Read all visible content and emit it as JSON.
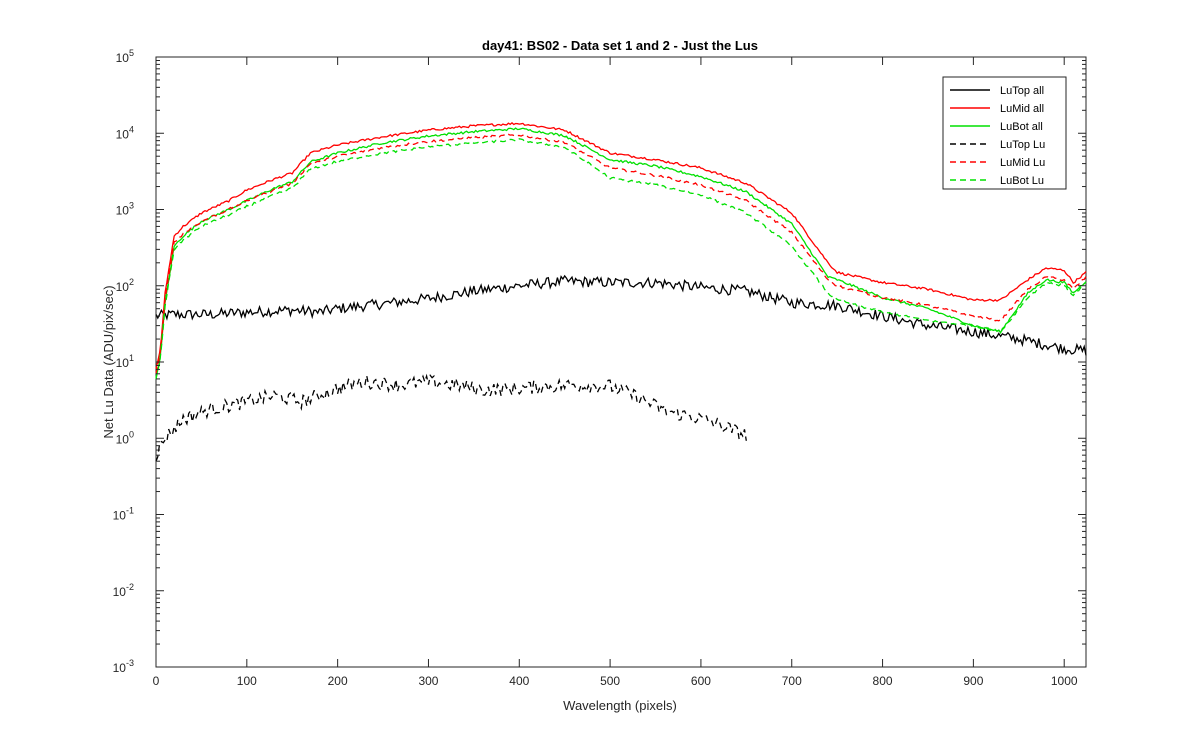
{
  "chart_data": {
    "type": "line",
    "title": "day41: BS02 - Data set 1 and 2 - Just the Lus",
    "xlabel": "Wavelength (pixels)",
    "ylabel": "Net Lu Data (ADU/pix/sec)",
    "xlim": [
      0,
      1024
    ],
    "ylim": [
      0.001,
      100000
    ],
    "yscale": "log",
    "grid": false,
    "legend_position": "top-right",
    "x_ticks": [
      "0",
      "100",
      "200",
      "300",
      "400",
      "500",
      "600",
      "700",
      "800",
      "900",
      "1000"
    ],
    "y_ticks": [
      {
        "base": "10",
        "exp": "-3"
      },
      {
        "base": "10",
        "exp": "-2"
      },
      {
        "base": "10",
        "exp": "-1"
      },
      {
        "base": "10",
        "exp": "0"
      },
      {
        "base": "10",
        "exp": "1"
      },
      {
        "base": "10",
        "exp": "2"
      },
      {
        "base": "10",
        "exp": "3"
      },
      {
        "base": "10",
        "exp": "4"
      },
      {
        "base": "10",
        "exp": "5"
      }
    ],
    "series": [
      {
        "name": "LuTop  all",
        "color": "#000000",
        "dash": "solid",
        "noise": 0.07,
        "x": [
          0,
          20,
          60,
          100,
          150,
          180,
          200,
          250,
          300,
          350,
          400,
          450,
          500,
          550,
          600,
          650,
          700,
          750,
          800,
          850,
          900,
          950,
          1000,
          1024
        ],
        "y": [
          40,
          42,
          42,
          45,
          48,
          45,
          50,
          58,
          68,
          85,
          100,
          115,
          110,
          110,
          95,
          85,
          60,
          55,
          40,
          30,
          25,
          20,
          15,
          14
        ]
      },
      {
        "name": "LuMid  all",
        "color": "#ff0000",
        "dash": "solid",
        "noise": 0.015,
        "x": [
          0,
          5,
          10,
          20,
          30,
          50,
          80,
          100,
          130,
          150,
          170,
          200,
          250,
          300,
          350,
          400,
          450,
          500,
          550,
          600,
          650,
          700,
          740,
          750,
          800,
          850,
          900,
          930,
          960,
          980,
          1000,
          1010,
          1024
        ],
        "y": [
          8,
          15,
          80,
          450,
          600,
          900,
          1300,
          1800,
          2500,
          3000,
          5500,
          7000,
          9000,
          11000,
          12500,
          13500,
          11000,
          5500,
          4500,
          3500,
          2200,
          900,
          200,
          150,
          110,
          90,
          65,
          65,
          120,
          170,
          160,
          110,
          150
        ]
      },
      {
        "name": "LuBot  all",
        "color": "#00e000",
        "dash": "solid",
        "noise": 0.015,
        "x": [
          0,
          5,
          10,
          20,
          30,
          50,
          80,
          100,
          130,
          150,
          170,
          200,
          250,
          300,
          350,
          400,
          450,
          500,
          550,
          600,
          650,
          700,
          740,
          750,
          800,
          850,
          900,
          930,
          960,
          980,
          1000,
          1010,
          1024
        ],
        "y": [
          6,
          12,
          60,
          330,
          450,
          700,
          1000,
          1300,
          1900,
          2300,
          4200,
          5500,
          7500,
          9200,
          10500,
          11500,
          9300,
          4500,
          3700,
          2700,
          1700,
          650,
          130,
          120,
          70,
          50,
          30,
          25,
          80,
          120,
          110,
          80,
          115
        ]
      },
      {
        "name": "LuTop  Lu",
        "color": "#000000",
        "dash": "dashed",
        "noise": 0.09,
        "x": [
          0,
          10,
          30,
          60,
          100,
          130,
          160,
          200,
          230,
          270,
          300,
          330,
          360,
          400,
          430,
          460,
          500,
          530,
          560,
          600,
          620,
          650
        ],
        "y": [
          0.6,
          1.0,
          1.8,
          2.4,
          3.0,
          3.6,
          3.0,
          4.5,
          5.5,
          5.0,
          5.5,
          5.0,
          4.3,
          4.5,
          4.8,
          5.0,
          4.8,
          3.5,
          2.3,
          1.8,
          1.5,
          1.1
        ]
      },
      {
        "name": "LuMid  Lu",
        "color": "#ff0000",
        "dash": "dashed",
        "noise": 0.015,
        "x": [
          0,
          5,
          10,
          20,
          30,
          50,
          80,
          100,
          130,
          150,
          170,
          200,
          250,
          300,
          350,
          400,
          450,
          500,
          550,
          600,
          650,
          700,
          740,
          750,
          800,
          850,
          900,
          930,
          960,
          980,
          1000,
          1010,
          1024
        ],
        "y": [
          7,
          13,
          65,
          370,
          480,
          700,
          1000,
          1300,
          1800,
          2200,
          4000,
          5000,
          6500,
          7800,
          8800,
          9500,
          7600,
          3500,
          2800,
          2100,
          1300,
          500,
          120,
          100,
          70,
          55,
          40,
          35,
          90,
          130,
          120,
          90,
          130
        ]
      },
      {
        "name": "LuBot  Lu",
        "color": "#00e000",
        "dash": "dashed",
        "noise": 0.015,
        "x": [
          0,
          5,
          10,
          20,
          30,
          50,
          80,
          100,
          130,
          150,
          170,
          200,
          250,
          300,
          350,
          400,
          450,
          500,
          550,
          600,
          650,
          700,
          740,
          750,
          800,
          850,
          900,
          930,
          960,
          980,
          1000,
          1010,
          1024
        ],
        "y": [
          6,
          11,
          55,
          300,
          400,
          600,
          850,
          1100,
          1550,
          1900,
          3400,
          4300,
          5500,
          6600,
          7500,
          8200,
          6500,
          2600,
          2100,
          1550,
          900,
          330,
          80,
          65,
          45,
          35,
          30,
          25,
          70,
          110,
          100,
          75,
          110
        ]
      }
    ]
  }
}
